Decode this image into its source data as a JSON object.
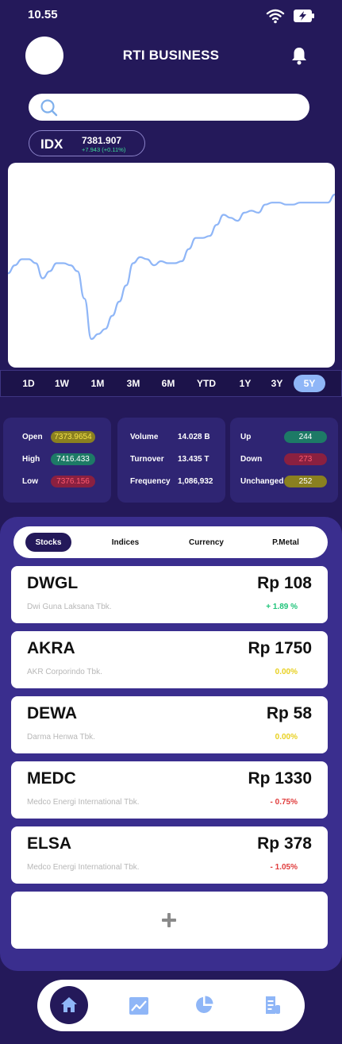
{
  "status": {
    "time": "10.55",
    "icons": [
      "wifi-icon",
      "battery-charging-icon"
    ]
  },
  "header": {
    "title": "RTI BUSINESS",
    "icons": [
      "avatar",
      "bell-icon"
    ]
  },
  "search": {
    "placeholder": ""
  },
  "index": {
    "name": "IDX",
    "value": "7381.907",
    "change": "+7.943 (+0.11%)"
  },
  "chart_data": {
    "type": "line",
    "series": [
      {
        "values": [
          70,
          62,
          56,
          56,
          60,
          75,
          68,
          60,
          60,
          62,
          68,
          95,
          135,
          130,
          125,
          112,
          98,
          82,
          60,
          54,
          56,
          62,
          58,
          60,
          60,
          58,
          46,
          35,
          35,
          33,
          22,
          12,
          15,
          18,
          10,
          8,
          10,
          2,
          0,
          0,
          2,
          2,
          0,
          0,
          0,
          0,
          0,
          -8
        ]
      }
    ],
    "color": "#8fb6f7",
    "xlabel": "",
    "ylabel": "",
    "grid": false
  },
  "ranges": {
    "items": [
      "1D",
      "1W",
      "1M",
      "3M",
      "6M",
      "YTD",
      "1Y",
      "3Y",
      "5Y"
    ],
    "active": "5Y"
  },
  "stats": {
    "prices": [
      {
        "label": "Open",
        "value": "7373.9654",
        "bg": "#8a8020",
        "fg": "#f5e54a"
      },
      {
        "label": "High",
        "value": "7416.433",
        "bg": "#1d7a66",
        "fg": "#ffffff"
      },
      {
        "label": "Low",
        "value": "7376.156",
        "bg": "#8a2040",
        "fg": "#ff5a6e"
      }
    ],
    "volume": [
      {
        "label": "Volume",
        "value": "14.028 B"
      },
      {
        "label": "Turnover",
        "value": "13.435 T"
      },
      {
        "label": "Frequency",
        "value": "1,086,932"
      }
    ],
    "breadth": [
      {
        "label": "Up",
        "value": "244",
        "bg": "#1d7a66",
        "fg": "#ffffff"
      },
      {
        "label": "Down",
        "value": "273",
        "bg": "#8a2040",
        "fg": "#ff5a6e"
      },
      {
        "label": "Unchanged",
        "value": "252",
        "bg": "#8a8020",
        "fg": "#ffffff"
      }
    ]
  },
  "tabs": {
    "items": [
      "Stocks",
      "Indices",
      "Currency",
      "P.Metal"
    ],
    "active": "Stocks"
  },
  "stocks": [
    {
      "ticker": "DWGL",
      "price": "Rp 108",
      "name": "Dwi Guna Laksana Tbk.",
      "change": "+ 1.89 %",
      "color": "#1fc47a"
    },
    {
      "ticker": "AKRA",
      "price": "Rp 1750",
      "name": "AKR Corporindo Tbk.",
      "change": "0.00%",
      "color": "#e8d020"
    },
    {
      "ticker": "DEWA",
      "price": "Rp 58",
      "name": "Darma Henwa Tbk.",
      "change": "0.00%",
      "color": "#e8d020"
    },
    {
      "ticker": "MEDC",
      "price": "Rp 1330",
      "name": "Medco Energi International Tbk.",
      "change": "- 0.75%",
      "color": "#e03c3c"
    },
    {
      "ticker": "ELSA",
      "price": "Rp 378",
      "name": "Medco Energi International Tbk.",
      "change": "- 1.05%",
      "color": "#e03c3c"
    }
  ],
  "add": {
    "icon": "plus-icon"
  },
  "nav": {
    "items": [
      "home-icon",
      "chart-icon",
      "pie-chart-icon",
      "document-icon"
    ],
    "active": "home-icon"
  },
  "colors": {
    "bg": "#24195a",
    "panel": "#3a2e8e",
    "accent": "#8fb6f7"
  }
}
